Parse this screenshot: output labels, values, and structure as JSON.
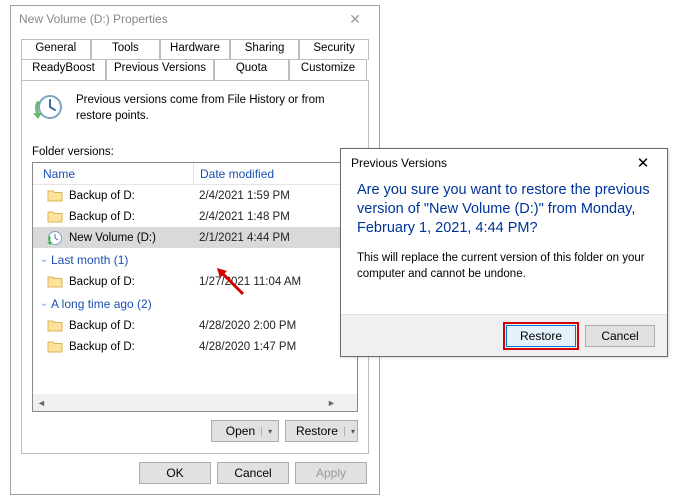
{
  "properties_window": {
    "title": "New Volume (D:) Properties",
    "tabs_row1": [
      "General",
      "Tools",
      "Hardware",
      "Sharing",
      "Security"
    ],
    "tabs_row2": [
      "ReadyBoost",
      "Previous Versions",
      "Quota",
      "Customize"
    ],
    "active_tab": "Previous Versions",
    "info_text": "Previous versions come from File History or from restore points.",
    "folder_versions_label": "Folder versions:",
    "columns": {
      "name": "Name",
      "date": "Date modified"
    },
    "rows": [
      {
        "type": "item",
        "icon": "folder",
        "name": "Backup of D:",
        "date": "2/4/2021 1:59 PM",
        "selected": false
      },
      {
        "type": "item",
        "icon": "folder",
        "name": "Backup of D:",
        "date": "2/4/2021 1:48 PM",
        "selected": false
      },
      {
        "type": "item",
        "icon": "drive",
        "name": "New Volume (D:)",
        "date": "2/1/2021 4:44 PM",
        "selected": true
      },
      {
        "type": "group",
        "label": "Last month (1)"
      },
      {
        "type": "item",
        "icon": "folder",
        "name": "Backup of D:",
        "date": "1/27/2021 11:04 AM",
        "selected": false
      },
      {
        "type": "group",
        "label": "A long time ago (2)"
      },
      {
        "type": "item",
        "icon": "folder",
        "name": "Backup of D:",
        "date": "4/28/2020 2:00 PM",
        "selected": false
      },
      {
        "type": "item",
        "icon": "folder",
        "name": "Backup of D:",
        "date": "4/28/2020 1:47 PM",
        "selected": false
      }
    ],
    "open_button": "Open",
    "restore_button": "Restore",
    "ok_button": "OK",
    "cancel_button": "Cancel",
    "apply_button": "Apply"
  },
  "confirm_dialog": {
    "title": "Previous Versions",
    "main_text": "Are you sure you want to restore the previous version of \"New Volume (D:)\" from Monday, February 1, 2021, 4:44 PM?",
    "sub_text": "This will replace the current version of this folder on your computer and cannot be undone.",
    "restore_button": "Restore",
    "cancel_button": "Cancel"
  }
}
